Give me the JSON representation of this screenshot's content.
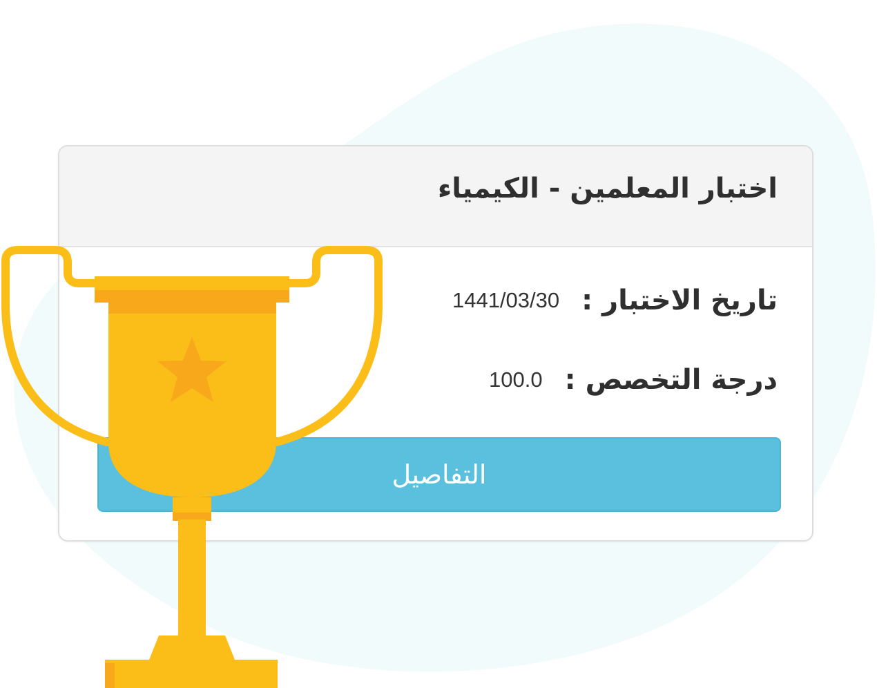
{
  "card": {
    "title": "اختبار المعلمين - الكيمياء",
    "rows": [
      {
        "label": "تاريخ الاختبار",
        "separator": ":",
        "value": "1441/03/30"
      },
      {
        "label": "درجة التخصص",
        "separator": ":",
        "value": "100.0"
      }
    ],
    "details_button_label": "التفاصيل"
  },
  "icons": {
    "trophy": "trophy-icon",
    "star": "star-icon"
  },
  "colors": {
    "button": "#5bc0de",
    "trophy_gold": "#fbbd18",
    "trophy_dark": "#f7a81b",
    "background_blob": "#f2fbfb"
  }
}
